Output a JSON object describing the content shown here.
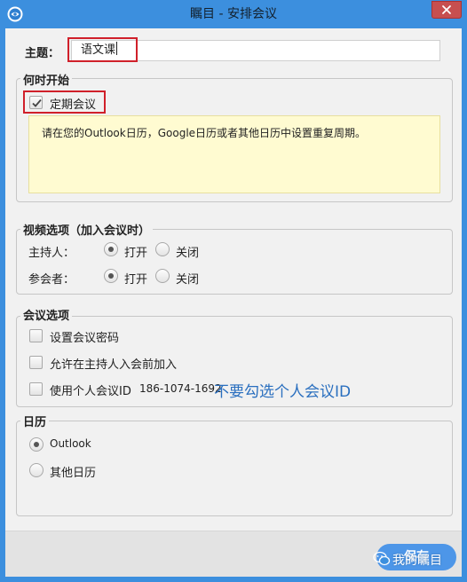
{
  "window": {
    "title": "瞩目 - 安排会议",
    "app_icon": "zhumu-logo-icon",
    "close_icon": "close-icon"
  },
  "subject": {
    "label": "主题：",
    "value": "语文课"
  },
  "when": {
    "title": "何时开始",
    "recurring_label": "定期会议",
    "recurring_checked": true,
    "note": "请在您的Outlook日历，Google日历或者其他日历中设置重复周期。"
  },
  "video": {
    "title": "视频选项（加入会议时）",
    "host_label": "主持人：",
    "participant_label": "参会者：",
    "on_label": "打开",
    "off_label": "关闭",
    "host_selected": "打开",
    "participant_selected": "打开"
  },
  "meeting_options": {
    "title": "会议选项",
    "password_label": "设置会议密码",
    "join_before_host_label": "允许在主持人入会前加入",
    "personal_id_label": "使用个人会议ID",
    "personal_id_value": "186-1074-1692",
    "annotation": "不要勾选个人会议ID",
    "password_checked": false,
    "join_before_host_checked": false,
    "personal_id_checked": false
  },
  "calendar": {
    "title": "日历",
    "outlook_label": "Outlook",
    "other_label": "其他日历",
    "selected": "Outlook"
  },
  "footer": {
    "save_label": "保存",
    "watermark": "我的瞩目"
  },
  "colors": {
    "titlebar": "#3c8fde",
    "highlight_box": "#d0202a",
    "annotation_text": "#2a6fbf",
    "note_background": "#fffbd1",
    "save_button": "#4d96e8"
  }
}
